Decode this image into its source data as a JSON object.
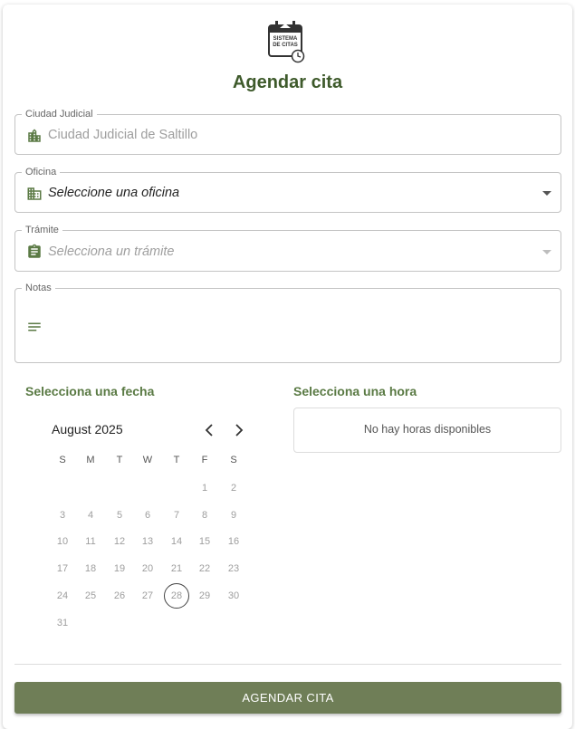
{
  "logo": {
    "line1": "SISTEMA",
    "line2": "DE CITAS"
  },
  "title": "Agendar cita",
  "fields": {
    "ciudad": {
      "label": "Ciudad Judicial",
      "value": "Ciudad Judicial de Saltillo",
      "icon": "city-icon"
    },
    "oficina": {
      "label": "Oficina",
      "placeholder": "Seleccione una oficina",
      "icon": "business-icon"
    },
    "tramite": {
      "label": "Trámite",
      "placeholder": "Selecciona un trámite",
      "icon": "assignment-icon"
    },
    "notas": {
      "label": "Notas",
      "value": "",
      "icon": "notes-icon"
    }
  },
  "calendar": {
    "section_title": "Selecciona una fecha",
    "month_label": "August 2025",
    "weekdays": [
      "S",
      "M",
      "T",
      "W",
      "T",
      "F",
      "S"
    ],
    "first_weekday": 5,
    "days_in_month": 31,
    "today": 28
  },
  "hours": {
    "section_title": "Selecciona una hora",
    "empty_text": "No hay horas disponibles"
  },
  "submit_label": "AGENDAR CITA",
  "colors": {
    "accent": "#3e5a2b",
    "section": "#5a7a44",
    "button": "#6f7e57",
    "icon": "#5b7a45"
  }
}
